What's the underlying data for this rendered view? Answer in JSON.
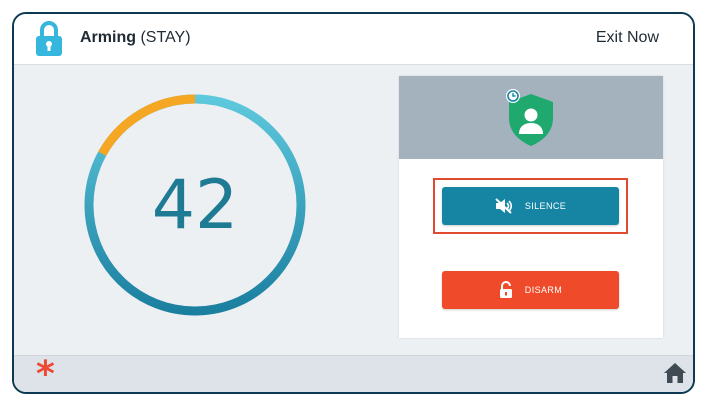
{
  "header": {
    "title_strong": "Arming",
    "title_mode": "(STAY)",
    "exit_label": "Exit Now",
    "icon": "lock-icon"
  },
  "countdown": {
    "value": "42",
    "elapsed_fraction": 0.17,
    "colors": {
      "elapsed": "#f5a623",
      "remaining_light": "#5ec8dc",
      "remaining_dark": "#1b7fa0"
    }
  },
  "status_panel": {
    "icon": "shield-user-icon",
    "badge_icon": "clock-icon",
    "shield_color": "#1fa96e",
    "silence_label": "SILENCE",
    "silence_icon": "speaker-mute-icon",
    "disarm_label": "DISARM",
    "disarm_icon": "unlock-icon",
    "highlight_color": "#e04a2f"
  },
  "footer": {
    "left_icon": "asterisk-icon",
    "left_glyph": "*",
    "right_icon": "home-icon"
  },
  "colors": {
    "accent": "#1685a3",
    "danger": "#ef4b2a",
    "background": "#ecf0f3"
  }
}
